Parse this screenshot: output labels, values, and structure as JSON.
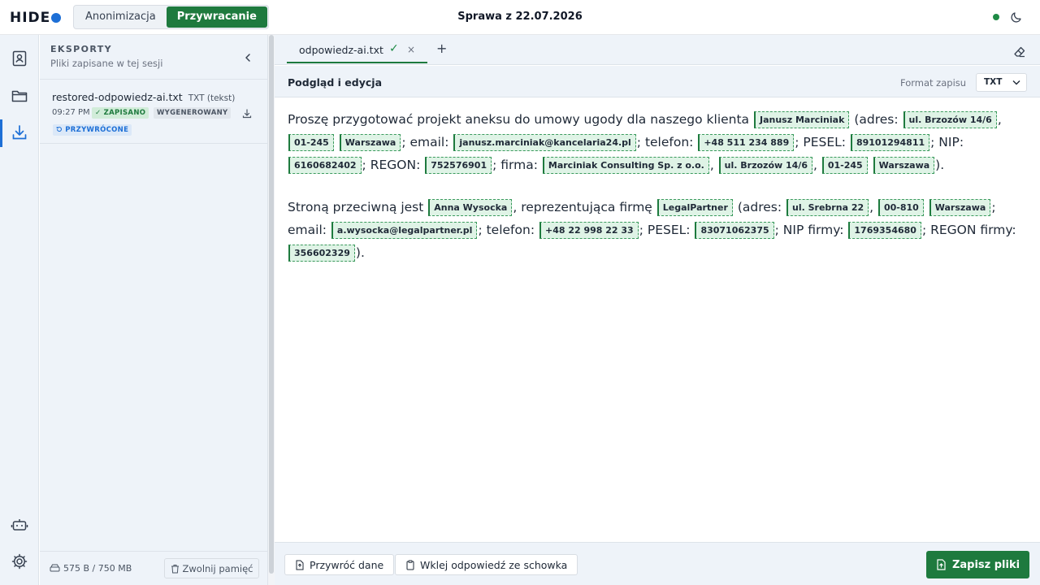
{
  "app": {
    "logo_text": "HIDE",
    "modes": [
      "Anonimizacja",
      "Przywracanie"
    ],
    "active_mode": "Przywracanie",
    "case_title": "Sprawa z 22.07.2026",
    "status_color": "#1e8a45"
  },
  "rail": {
    "items": [
      "contacts-icon",
      "folder-icon",
      "download-icon",
      "robot-icon",
      "settings-icon"
    ],
    "active": "download-icon"
  },
  "sidebar": {
    "title": "EKSPORTY",
    "subtitle": "Pliki zapisane w tej sesji",
    "files": [
      {
        "name": "restored-odpowiedz-ai.txt",
        "type": "TXT (tekst)",
        "time": "09:27 PM",
        "badges": [
          "✓ ZAPISANO",
          "WYGENEROWANY",
          "PRZYWRÓCONE"
        ]
      }
    ],
    "storage": "575 B / 750 MB",
    "free_button": "Zwolnij pamięć"
  },
  "tabs": [
    {
      "label": "odpowiedz-ai.txt",
      "saved_mark": "✓",
      "close": "×"
    }
  ],
  "tab_add": "+",
  "editor": {
    "title": "Podgląd i edycja",
    "format_label": "Format zapisu",
    "format_value": "TXT",
    "paragraphs": [
      [
        {
          "t": "Proszę przygotować projekt aneksu do umowy ugody dla naszego klienta "
        },
        {
          "tok": "Janusz Marciniak"
        },
        {
          "t": " (adres: "
        },
        {
          "tok": "ul. Brzozów 14/6"
        },
        {
          "t": ", "
        },
        {
          "tok": "01-245"
        },
        {
          "t": " "
        },
        {
          "tok": "Warszawa"
        },
        {
          "t": "; email: "
        },
        {
          "tok": "janusz.marciniak@kancelaria24.pl"
        },
        {
          "t": "; telefon: "
        },
        {
          "tok": "+48 511 234 889"
        },
        {
          "t": "; PESEL: "
        },
        {
          "tok": "89101294811"
        },
        {
          "t": "; NIP: "
        },
        {
          "tok": "6160682402"
        },
        {
          "t": "; REGON: "
        },
        {
          "tok": "752576901"
        },
        {
          "t": "; firma: "
        },
        {
          "tok": "Marciniak Consulting Sp. z o.o."
        },
        {
          "t": ", "
        },
        {
          "tok": "ul. Brzozów 14/6"
        },
        {
          "t": ", "
        },
        {
          "tok": "01-245"
        },
        {
          "t": " "
        },
        {
          "tok": "Warszawa"
        },
        {
          "t": ")."
        }
      ],
      [
        {
          "t": "Stroną przeciwną jest "
        },
        {
          "tok": "Anna Wysocka"
        },
        {
          "t": ", reprezentująca firmę "
        },
        {
          "tok": "LegalPartner"
        },
        {
          "t": " (adres: "
        },
        {
          "tok": "ul. Srebrna 22"
        },
        {
          "t": ", "
        },
        {
          "tok": "00-810"
        },
        {
          "t": " "
        },
        {
          "tok": "Warszawa"
        },
        {
          "t": "; email: "
        },
        {
          "tok": "a.wysocka@legalpartner.pl"
        },
        {
          "t": "; telefon: "
        },
        {
          "tok": "+48 22 998 22 33"
        },
        {
          "t": "; PESEL: "
        },
        {
          "tok": "83071062375"
        },
        {
          "t": "; NIP firmy: "
        },
        {
          "tok": "1769354680"
        },
        {
          "t": "; REGON firmy: "
        },
        {
          "tok": "356602329"
        },
        {
          "t": ")."
        }
      ]
    ]
  },
  "footer": {
    "restore_button": "Przywróć dane",
    "paste_button": "Wklej odpowiedź ze schowka",
    "save_button": "Zapisz pliki"
  },
  "colors": {
    "accent_green": "#1e7a3e",
    "accent_blue": "#1d6fd6",
    "token_bg": "#dff3e6"
  }
}
